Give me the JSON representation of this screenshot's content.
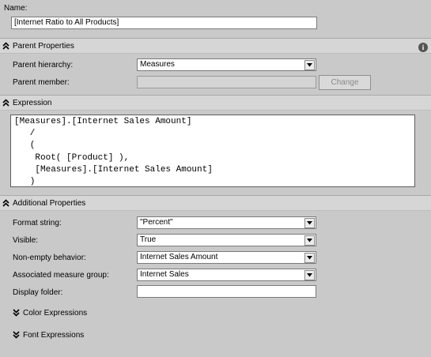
{
  "name": {
    "label": "Name:",
    "value": "[Internet Ratio to All Products]"
  },
  "parent_properties": {
    "title": "Parent Properties",
    "hierarchy_label": "Parent hierarchy:",
    "hierarchy_value": "Measures",
    "member_label": "Parent member:",
    "member_value": "",
    "change_label": "Change"
  },
  "expression": {
    "title": "Expression",
    "lines": [
      "[Measures].[Internet Sales Amount]",
      "   /",
      "   (",
      "    Root( [Product] ),",
      "    [Measures].[Internet Sales Amount]",
      "   )"
    ]
  },
  "additional_properties": {
    "title": "Additional Properties",
    "format_label": "Format string:",
    "format_value": "\"Percent\"",
    "visible_label": "Visible:",
    "visible_value": "True",
    "nonempty_label": "Non-empty behavior:",
    "nonempty_value": "Internet Sales Amount",
    "group_label": "Associated measure group:",
    "group_value": "Internet Sales",
    "folder_label": "Display folder:",
    "folder_value": "",
    "color_expr": "Color Expressions",
    "font_expr": "Font Expressions"
  },
  "icons": {
    "collapse": "double-chevron-up-icon",
    "expand": "double-chevron-down-icon",
    "info": "info-icon",
    "dropdown": "dropdown-arrow-icon"
  },
  "colors": {
    "background": "#c9c9c9",
    "band": "#d6d6d6",
    "field": "#ffffff",
    "disabled_field": "#d4d4d4"
  }
}
